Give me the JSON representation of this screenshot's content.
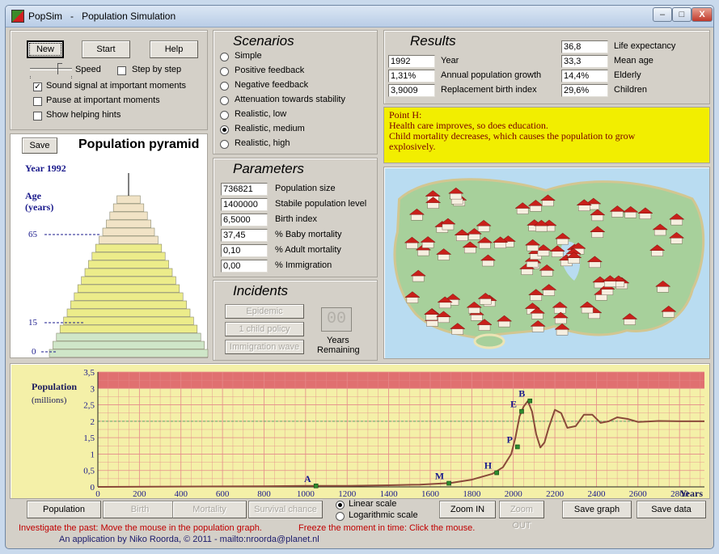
{
  "window": {
    "app_name": "PopSim",
    "separator": "-",
    "title": "Population Simulation",
    "controls": [
      "–",
      "□",
      "X"
    ]
  },
  "controls": {
    "new_label": "New",
    "start_label": "Start",
    "help_label": "Help",
    "speed_label": "Speed",
    "step_label": "Step by step",
    "step_checked": false,
    "sound_label": "Sound signal at important moments",
    "sound_checked": true,
    "pause_label": "Pause at important moments",
    "pause_checked": false,
    "hints_label": "Show helping hints",
    "hints_checked": false
  },
  "scenarios": {
    "title": "Scenarios",
    "options": [
      "Simple",
      "Positive feedback",
      "Negative feedback",
      "Attenuation towards stability",
      "Realistic, low",
      "Realistic, medium",
      "Realistic, high"
    ],
    "selected": "Realistic, medium"
  },
  "results": {
    "title": "Results",
    "left": [
      {
        "value": "1992",
        "label": "Year"
      },
      {
        "value": "1,31%",
        "label": "Annual population growth"
      },
      {
        "value": "3,9009",
        "label": "Replacement birth index"
      }
    ],
    "right": [
      {
        "value": "36,8",
        "label": "Life expectancy"
      },
      {
        "value": "33,3",
        "label": "Mean age"
      },
      {
        "value": "14,4%",
        "label": "Elderly"
      },
      {
        "value": "29,6%",
        "label": "Children"
      }
    ]
  },
  "message": {
    "lines": [
      "Point H:",
      "Health care improves, so does education.",
      "Child mortality decreases, which causes the population to grow",
      "explosively."
    ],
    "bg_color": "#f2ee00",
    "text_color": "#7a0000"
  },
  "pyramid": {
    "save_label": "Save",
    "title": "Population pyramid",
    "year_label": "Year 1992",
    "age_label_1": "Age",
    "age_label_2": "(years)",
    "ticks": [
      "65",
      "15",
      "0"
    ],
    "colors": {
      "youth": "#cfe6c8",
      "adult": "#ecec8a",
      "elderly": "#f1e3c6",
      "text": "#1a1a8c"
    }
  },
  "parameters": {
    "title": "Parameters",
    "items": [
      {
        "value": "736821",
        "label": "Population size"
      },
      {
        "value": "1400000",
        "label": "Stabile population level"
      },
      {
        "value": "6,5000",
        "label": "Birth index"
      },
      {
        "value": "37,45",
        "label": "% Baby mortality"
      },
      {
        "value": "0,10",
        "label": "% Adult mortality"
      },
      {
        "value": "0,00",
        "label": "% Immigration"
      }
    ]
  },
  "incidents": {
    "title": "Incidents",
    "buttons": [
      "Epidemic",
      "1 child policy",
      "Immigration wave"
    ],
    "counter": "00",
    "years_label": "Years",
    "remaining_label": "Remaining"
  },
  "map": {
    "colors": {
      "water": "#b9dcf1",
      "land": "#a7d09b",
      "sand": "#ece4b4",
      "roof": "#c8201a",
      "wall": "#f6efe0"
    }
  },
  "chart_data": {
    "type": "line",
    "ylabel": "Population",
    "ylabel_unit": "(millions)",
    "xlabel": "Years",
    "xlim": [
      0,
      2920
    ],
    "ylim": [
      0,
      3.5
    ],
    "x_ticks": [
      "0",
      "200",
      "400",
      "600",
      "800",
      "1000",
      "1200",
      "1400",
      "1600",
      "1800",
      "2000",
      "2200",
      "2400",
      "2600",
      "2800"
    ],
    "y_ticks": [
      "0",
      "0,5",
      "1",
      "1,5",
      "2",
      "2,5",
      "3",
      "3,5"
    ],
    "grid": true,
    "stable_level": 2,
    "upper_band": [
      3,
      3.5
    ],
    "series": [
      {
        "x": [
          0,
          400,
          800,
          1000,
          1200,
          1400,
          1550,
          1650,
          1700,
          1800,
          1900,
          1950,
          1990,
          2010,
          2030,
          2050,
          2070,
          2090,
          2110,
          2130,
          2150,
          2170,
          2200,
          2230,
          2260,
          2300,
          2340,
          2380,
          2420,
          2460,
          2500,
          2550,
          2600,
          2700,
          2800,
          2920
        ],
        "y": [
          0.0,
          0.01,
          0.02,
          0.03,
          0.03,
          0.05,
          0.07,
          0.1,
          0.12,
          0.22,
          0.4,
          0.6,
          1.0,
          1.5,
          2.15,
          2.45,
          2.62,
          2.3,
          1.6,
          1.2,
          1.35,
          1.8,
          2.35,
          2.25,
          1.8,
          1.85,
          2.2,
          2.2,
          1.95,
          2.0,
          2.12,
          2.07,
          1.98,
          2.01,
          2.0,
          2.0
        ]
      }
    ],
    "points": [
      {
        "label": "A",
        "x": 1050,
        "y": 0.03
      },
      {
        "label": "M",
        "x": 1690,
        "y": 0.11
      },
      {
        "label": "H",
        "x": 1920,
        "y": 0.43
      },
      {
        "label": "P",
        "x": 2020,
        "y": 1.22
      },
      {
        "label": "E",
        "x": 2040,
        "y": 2.3
      },
      {
        "label": "B",
        "x": 2080,
        "y": 2.62
      }
    ],
    "colors": {
      "bg": "#f4f0a8",
      "band": "#e07070",
      "grid": "#e58a8a",
      "line": "#8a4a3a",
      "stable": "#5da56e",
      "point": "#2e8b2e",
      "label": "#1a1a8c"
    }
  },
  "bottom": {
    "buttons": [
      "Population",
      "Birth",
      "Mortality",
      "Survival chance"
    ],
    "scale_linear": "Linear scale",
    "scale_log": "Logarithmic scale",
    "zoom_in": "Zoom IN",
    "zoom_out": "Zoom OUT",
    "save_graph": "Save graph",
    "save_data": "Save data"
  },
  "status": {
    "line1a": "Investigate the past:  Move the mouse in the population graph.",
    "line1b": "Freeze the moment in time: Click the mouse.",
    "line2": "An application by Niko Roorda, © 2011  -  mailto:nroorda@planet.nl"
  }
}
